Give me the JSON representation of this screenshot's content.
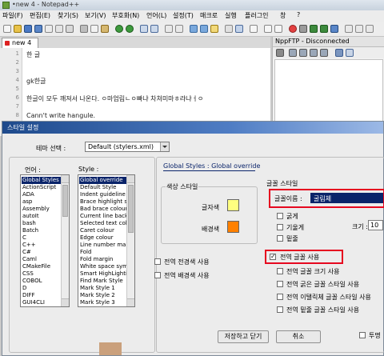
{
  "window": {
    "title": "•new 4 - Notepad++"
  },
  "menu": [
    "파일(F)",
    "편집(E)",
    "찾기(S)",
    "보기(V)",
    "부호화(N)",
    "언어(L)",
    "설정(T)",
    "매크로",
    "실행",
    "플러그인",
    "창",
    "?"
  ],
  "tab": {
    "label": "new 4"
  },
  "editor": {
    "lines": [
      {
        "n": "1",
        "text": "한 글"
      },
      {
        "n": "2",
        "text": ""
      },
      {
        "n": "3",
        "text": ""
      },
      {
        "n": "4",
        "text": "gk한글"
      },
      {
        "n": "5",
        "text": ""
      },
      {
        "n": "6",
        "text": "한글이 모두 깨져서 나온다. ㅇ마엄림ㄴㅇ빠냐 차쳐미마ㅎ랴냐ㅓㅇ"
      },
      {
        "n": "7",
        "text": ""
      },
      {
        "n": "8",
        "text": "Cann't write hangule."
      }
    ]
  },
  "nppftp": {
    "title": "NppFTP - Disconnected"
  },
  "dialog": {
    "title": "스타일 설정",
    "theme_label": "테마 선택 :",
    "theme_value": "Default (stylers.xml)",
    "language_label": "언어 :",
    "style_label": "Style :",
    "languages": [
      "Global Styles",
      "ActionScript",
      "ADA",
      "asp",
      "Assembly",
      "autoIt",
      "bash",
      "Batch",
      "C",
      "C++",
      "C#",
      "Caml",
      "CMakeFile",
      "CSS",
      "COBOL",
      "D",
      "DIFF",
      "GUI4CLI"
    ],
    "styles": [
      "Global override",
      "Default Style",
      "Indent guideline style",
      "Brace highlight style",
      "Bad brace colour",
      "Current line background",
      "Selected text colour",
      "Caret colour",
      "Edge colour",
      "Line number margin",
      "Fold",
      "Fold margin",
      "White space symbol",
      "Smart HighLighting",
      "Find Mark Style",
      "Mark Style 1",
      "Mark Style 2",
      "Mark Style 3"
    ],
    "breadcrumb": "Global Styles : Global override",
    "color_group_title": "색상 스타일",
    "fg_label": "글자색",
    "bg_label": "배경색",
    "fg_color": "#ffff80",
    "bg_color": "#ff8000",
    "global_fg": "전역 전경색 사용",
    "global_bg": "전역 배경색 사용",
    "font_group_title": "글꼴 스타일",
    "font_name_label": "글꼴이름 :",
    "font_name_value": "굴림체",
    "bold_label": "굵게",
    "italic_label": "기울게",
    "underline_label": "밑줄",
    "size_label": "크기 :",
    "size_value": "10",
    "use_global_font": "전역 글꼴 사용",
    "use_global_font_size": "전역 글꼴 크기 사용",
    "use_global_bold": "전역 굵은 글꼴 스타일 사용",
    "use_global_italic": "전역 이탤릭체 글꼴 스타일 사용",
    "use_global_underline": "전역 밑줄 글꼴 스타일 사용",
    "save_close": "저장하고 닫기",
    "cancel": "취소",
    "transparency": "투명"
  }
}
